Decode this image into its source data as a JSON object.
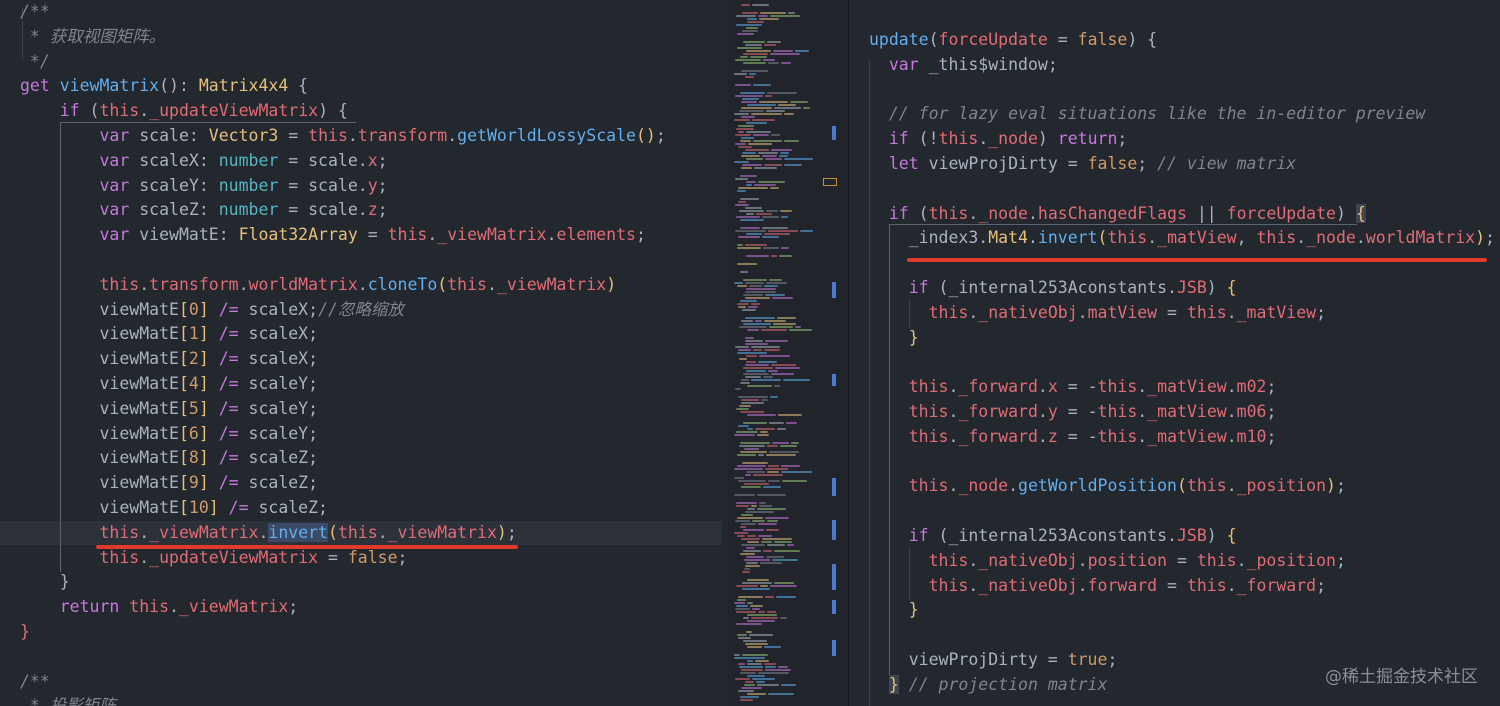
{
  "left_code": [
    [
      [
        "c",
        "/**"
      ]
    ],
    [
      [
        "c",
        " * 获取视图矩阵。"
      ]
    ],
    [
      [
        "c",
        " */"
      ]
    ],
    [
      [
        "k",
        "get "
      ],
      [
        "f",
        "viewMatrix"
      ],
      [
        "w",
        "(): "
      ],
      [
        "t",
        "Matrix4x4"
      ],
      [
        "w",
        " {"
      ]
    ],
    [
      [
        "w",
        "    "
      ],
      [
        "k",
        "if"
      ],
      [
        "w",
        " ("
      ],
      [
        "p",
        "this"
      ],
      [
        "w",
        "."
      ],
      [
        "p",
        "_updateViewMatrix"
      ],
      [
        "w",
        ") {"
      ]
    ],
    [
      [
        "w",
        "        "
      ],
      [
        "k",
        "var"
      ],
      [
        "w",
        " scale: "
      ],
      [
        "t",
        "Vector3"
      ],
      [
        "w",
        " = "
      ],
      [
        "p",
        "this"
      ],
      [
        "w",
        "."
      ],
      [
        "p",
        "transform"
      ],
      [
        "w",
        "."
      ],
      [
        "f",
        "getWorldLossyScale"
      ],
      [
        "y",
        "()"
      ],
      [
        "w",
        ";"
      ]
    ],
    [
      [
        "w",
        "        "
      ],
      [
        "k",
        "var"
      ],
      [
        "w",
        " scaleX: "
      ],
      [
        "o",
        "number"
      ],
      [
        "w",
        " = scale."
      ],
      [
        "p",
        "x"
      ],
      [
        "w",
        ";"
      ]
    ],
    [
      [
        "w",
        "        "
      ],
      [
        "k",
        "var"
      ],
      [
        "w",
        " scaleY: "
      ],
      [
        "o",
        "number"
      ],
      [
        "w",
        " = scale."
      ],
      [
        "p",
        "y"
      ],
      [
        "w",
        ";"
      ]
    ],
    [
      [
        "w",
        "        "
      ],
      [
        "k",
        "var"
      ],
      [
        "w",
        " scaleZ: "
      ],
      [
        "o",
        "number"
      ],
      [
        "w",
        " = scale."
      ],
      [
        "p",
        "z"
      ],
      [
        "w",
        ";"
      ]
    ],
    [
      [
        "w",
        "        "
      ],
      [
        "k",
        "var"
      ],
      [
        "w",
        " viewMatE: "
      ],
      [
        "t",
        "Float32Array"
      ],
      [
        "w",
        " = "
      ],
      [
        "p",
        "this"
      ],
      [
        "w",
        "."
      ],
      [
        "p",
        "_viewMatrix"
      ],
      [
        "w",
        "."
      ],
      [
        "p",
        "elements"
      ],
      [
        "w",
        ";"
      ]
    ],
    [
      [
        "w",
        ""
      ]
    ],
    [
      [
        "w",
        "        "
      ],
      [
        "p",
        "this"
      ],
      [
        "w",
        "."
      ],
      [
        "p",
        "transform"
      ],
      [
        "w",
        "."
      ],
      [
        "p",
        "worldMatrix"
      ],
      [
        "w",
        "."
      ],
      [
        "f",
        "cloneTo"
      ],
      [
        "y",
        "("
      ],
      [
        "p",
        "this"
      ],
      [
        "w",
        "."
      ],
      [
        "p",
        "_viewMatrix"
      ],
      [
        "y",
        ")"
      ]
    ],
    [
      [
        "w",
        "        viewMatE"
      ],
      [
        "y",
        "["
      ],
      [
        "n",
        "0"
      ],
      [
        "y",
        "]"
      ],
      [
        "w",
        " "
      ],
      [
        "k",
        "/="
      ],
      [
        "w",
        " scaleX;"
      ],
      [
        "c",
        "//忽略缩放"
      ]
    ],
    [
      [
        "w",
        "        viewMatE"
      ],
      [
        "y",
        "["
      ],
      [
        "n",
        "1"
      ],
      [
        "y",
        "]"
      ],
      [
        "w",
        " "
      ],
      [
        "k",
        "/="
      ],
      [
        "w",
        " scaleX;"
      ]
    ],
    [
      [
        "w",
        "        viewMatE"
      ],
      [
        "y",
        "["
      ],
      [
        "n",
        "2"
      ],
      [
        "y",
        "]"
      ],
      [
        "w",
        " "
      ],
      [
        "k",
        "/="
      ],
      [
        "w",
        " scaleX;"
      ]
    ],
    [
      [
        "w",
        "        viewMatE"
      ],
      [
        "y",
        "["
      ],
      [
        "n",
        "4"
      ],
      [
        "y",
        "]"
      ],
      [
        "w",
        " "
      ],
      [
        "k",
        "/="
      ],
      [
        "w",
        " scaleY;"
      ]
    ],
    [
      [
        "w",
        "        viewMatE"
      ],
      [
        "y",
        "["
      ],
      [
        "n",
        "5"
      ],
      [
        "y",
        "]"
      ],
      [
        "w",
        " "
      ],
      [
        "k",
        "/="
      ],
      [
        "w",
        " scaleY;"
      ]
    ],
    [
      [
        "w",
        "        viewMatE"
      ],
      [
        "y",
        "["
      ],
      [
        "n",
        "6"
      ],
      [
        "y",
        "]"
      ],
      [
        "w",
        " "
      ],
      [
        "k",
        "/="
      ],
      [
        "w",
        " scaleY;"
      ]
    ],
    [
      [
        "w",
        "        viewMatE"
      ],
      [
        "y",
        "["
      ],
      [
        "n",
        "8"
      ],
      [
        "y",
        "]"
      ],
      [
        "w",
        " "
      ],
      [
        "k",
        "/="
      ],
      [
        "w",
        " scaleZ;"
      ]
    ],
    [
      [
        "w",
        "        viewMatE"
      ],
      [
        "y",
        "["
      ],
      [
        "n",
        "9"
      ],
      [
        "y",
        "]"
      ],
      [
        "w",
        " "
      ],
      [
        "k",
        "/="
      ],
      [
        "w",
        " scaleZ;"
      ]
    ],
    [
      [
        "w",
        "        viewMatE"
      ],
      [
        "y",
        "["
      ],
      [
        "n",
        "10"
      ],
      [
        "y",
        "]"
      ],
      [
        "w",
        " "
      ],
      [
        "k",
        "/="
      ],
      [
        "w",
        " scaleZ;"
      ]
    ],
    [
      [
        "w",
        "        "
      ],
      [
        "p",
        "this"
      ],
      [
        "w",
        "."
      ],
      [
        "p",
        "_viewMatrix"
      ],
      [
        "w",
        "."
      ],
      [
        "f hl-word",
        "invert"
      ],
      [
        "y",
        "("
      ],
      [
        "p",
        "this"
      ],
      [
        "w",
        "."
      ],
      [
        "p",
        "_viewMatrix"
      ],
      [
        "y",
        ")"
      ],
      [
        "w",
        ";"
      ]
    ],
    [
      [
        "w",
        "        "
      ],
      [
        "p",
        "this"
      ],
      [
        "w",
        "."
      ],
      [
        "p",
        "_updateViewMatrix"
      ],
      [
        "w",
        " = "
      ],
      [
        "n",
        "false"
      ],
      [
        "w",
        ";"
      ]
    ],
    [
      [
        "w",
        "    }"
      ]
    ],
    [
      [
        "w",
        "    "
      ],
      [
        "k",
        "return "
      ],
      [
        "p",
        "this"
      ],
      [
        "w",
        "."
      ],
      [
        "p",
        "_viewMatrix"
      ],
      [
        "w",
        ";"
      ]
    ],
    [
      [
        "p",
        "}"
      ]
    ],
    [
      [
        "w",
        ""
      ]
    ],
    [
      [
        "c",
        "/**"
      ]
    ],
    [
      [
        "c",
        " * 投影矩阵"
      ]
    ]
  ],
  "right_code": [
    [
      [
        "f",
        "update"
      ],
      [
        "w",
        "("
      ],
      [
        "p",
        "forceUpdate"
      ],
      [
        "w",
        " = "
      ],
      [
        "n",
        "false"
      ],
      [
        "w",
        ") {"
      ]
    ],
    [
      [
        "w",
        "  "
      ],
      [
        "k",
        "var"
      ],
      [
        "w",
        " _this$window;"
      ]
    ],
    [
      [
        "w",
        ""
      ]
    ],
    [
      [
        "c",
        "  // for lazy eval situations like the in-editor preview"
      ]
    ],
    [
      [
        "w",
        "  "
      ],
      [
        "k",
        "if"
      ],
      [
        "w",
        " (!"
      ],
      [
        "p",
        "this"
      ],
      [
        "w",
        "."
      ],
      [
        "p",
        "_node"
      ],
      [
        "w",
        ") "
      ],
      [
        "k",
        "return"
      ],
      [
        "w",
        ";"
      ]
    ],
    [
      [
        "w",
        "  "
      ],
      [
        "k",
        "let"
      ],
      [
        "w",
        " viewProjDirty = "
      ],
      [
        "n",
        "false"
      ],
      [
        "w",
        "; "
      ],
      [
        "c",
        "// view matrix"
      ]
    ],
    [
      [
        "w",
        ""
      ]
    ],
    [
      [
        "w",
        "  "
      ],
      [
        "k",
        "if"
      ],
      [
        "w",
        " ("
      ],
      [
        "p",
        "this"
      ],
      [
        "w",
        "."
      ],
      [
        "p",
        "_node"
      ],
      [
        "w",
        "."
      ],
      [
        "p",
        "hasChangedFlags"
      ],
      [
        "w",
        " || "
      ],
      [
        "p",
        "forceUpdate"
      ],
      [
        "w",
        ") "
      ],
      [
        "y sel",
        "{"
      ]
    ],
    [
      [
        "w",
        "    _index3."
      ],
      [
        "t",
        "Mat4"
      ],
      [
        "w",
        "."
      ],
      [
        "f",
        "invert"
      ],
      [
        "y",
        "("
      ],
      [
        "p",
        "this"
      ],
      [
        "w",
        "."
      ],
      [
        "p",
        "_matView"
      ],
      [
        "w",
        ", "
      ],
      [
        "p",
        "this"
      ],
      [
        "w",
        "."
      ],
      [
        "p",
        "_node"
      ],
      [
        "w",
        "."
      ],
      [
        "p",
        "worldMatrix"
      ],
      [
        "y",
        ")"
      ],
      [
        "w",
        ";"
      ]
    ],
    [
      [
        "w",
        ""
      ]
    ],
    [
      [
        "w",
        "    "
      ],
      [
        "k",
        "if"
      ],
      [
        "w",
        " (_internal253Aconstants."
      ],
      [
        "p",
        "JSB"
      ],
      [
        "w",
        ") "
      ],
      [
        "y",
        "{"
      ]
    ],
    [
      [
        "w",
        "      "
      ],
      [
        "p",
        "this"
      ],
      [
        "w",
        "."
      ],
      [
        "p",
        "_nativeObj"
      ],
      [
        "w",
        "."
      ],
      [
        "p",
        "matView"
      ],
      [
        "w",
        " = "
      ],
      [
        "p",
        "this"
      ],
      [
        "w",
        "."
      ],
      [
        "p",
        "_matView"
      ],
      [
        "w",
        ";"
      ]
    ],
    [
      [
        "w",
        "    "
      ],
      [
        "y",
        "}"
      ]
    ],
    [
      [
        "w",
        ""
      ]
    ],
    [
      [
        "w",
        "    "
      ],
      [
        "p",
        "this"
      ],
      [
        "w",
        "."
      ],
      [
        "p",
        "_forward"
      ],
      [
        "w",
        "."
      ],
      [
        "p",
        "x"
      ],
      [
        "w",
        " = -"
      ],
      [
        "p",
        "this"
      ],
      [
        "w",
        "."
      ],
      [
        "p",
        "_matView"
      ],
      [
        "w",
        "."
      ],
      [
        "p",
        "m02"
      ],
      [
        "w",
        ";"
      ]
    ],
    [
      [
        "w",
        "    "
      ],
      [
        "p",
        "this"
      ],
      [
        "w",
        "."
      ],
      [
        "p",
        "_forward"
      ],
      [
        "w",
        "."
      ],
      [
        "p",
        "y"
      ],
      [
        "w",
        " = -"
      ],
      [
        "p",
        "this"
      ],
      [
        "w",
        "."
      ],
      [
        "p",
        "_matView"
      ],
      [
        "w",
        "."
      ],
      [
        "p",
        "m06"
      ],
      [
        "w",
        ";"
      ]
    ],
    [
      [
        "w",
        "    "
      ],
      [
        "p",
        "this"
      ],
      [
        "w",
        "."
      ],
      [
        "p",
        "_forward"
      ],
      [
        "w",
        "."
      ],
      [
        "p",
        "z"
      ],
      [
        "w",
        " = -"
      ],
      [
        "p",
        "this"
      ],
      [
        "w",
        "."
      ],
      [
        "p",
        "_matView"
      ],
      [
        "w",
        "."
      ],
      [
        "p",
        "m10"
      ],
      [
        "w",
        ";"
      ]
    ],
    [
      [
        "w",
        ""
      ]
    ],
    [
      [
        "w",
        "    "
      ],
      [
        "p",
        "this"
      ],
      [
        "w",
        "."
      ],
      [
        "p",
        "_node"
      ],
      [
        "w",
        "."
      ],
      [
        "f",
        "getWorldPosition"
      ],
      [
        "y",
        "("
      ],
      [
        "p",
        "this"
      ],
      [
        "w",
        "."
      ],
      [
        "p",
        "_position"
      ],
      [
        "y",
        ")"
      ],
      [
        "w",
        ";"
      ]
    ],
    [
      [
        "w",
        ""
      ]
    ],
    [
      [
        "w",
        "    "
      ],
      [
        "k",
        "if"
      ],
      [
        "w",
        " (_internal253Aconstants."
      ],
      [
        "p",
        "JSB"
      ],
      [
        "w",
        ") "
      ],
      [
        "y",
        "{"
      ]
    ],
    [
      [
        "w",
        "      "
      ],
      [
        "p",
        "this"
      ],
      [
        "w",
        "."
      ],
      [
        "p",
        "_nativeObj"
      ],
      [
        "w",
        "."
      ],
      [
        "p",
        "position"
      ],
      [
        "w",
        " = "
      ],
      [
        "p",
        "this"
      ],
      [
        "w",
        "."
      ],
      [
        "p",
        "_position"
      ],
      [
        "w",
        ";"
      ]
    ],
    [
      [
        "w",
        "      "
      ],
      [
        "p",
        "this"
      ],
      [
        "w",
        "."
      ],
      [
        "p",
        "_nativeObj"
      ],
      [
        "w",
        "."
      ],
      [
        "p",
        "forward"
      ],
      [
        "w",
        " = "
      ],
      [
        "p",
        "this"
      ],
      [
        "w",
        "."
      ],
      [
        "p",
        "_forward"
      ],
      [
        "w",
        ";"
      ]
    ],
    [
      [
        "w",
        "    "
      ],
      [
        "y",
        "}"
      ]
    ],
    [
      [
        "w",
        ""
      ]
    ],
    [
      [
        "w",
        "    viewProjDirty = "
      ],
      [
        "n",
        "true"
      ],
      [
        "w",
        ";"
      ]
    ],
    [
      [
        "w",
        "  "
      ],
      [
        "y sel",
        "}"
      ],
      [
        "c",
        " // projection matrix"
      ]
    ]
  ],
  "colors": {
    "underline": "#e03a2a",
    "background": "#23272e",
    "minimap": "#21252b"
  },
  "watermark": "@稀土掘金技术社区"
}
